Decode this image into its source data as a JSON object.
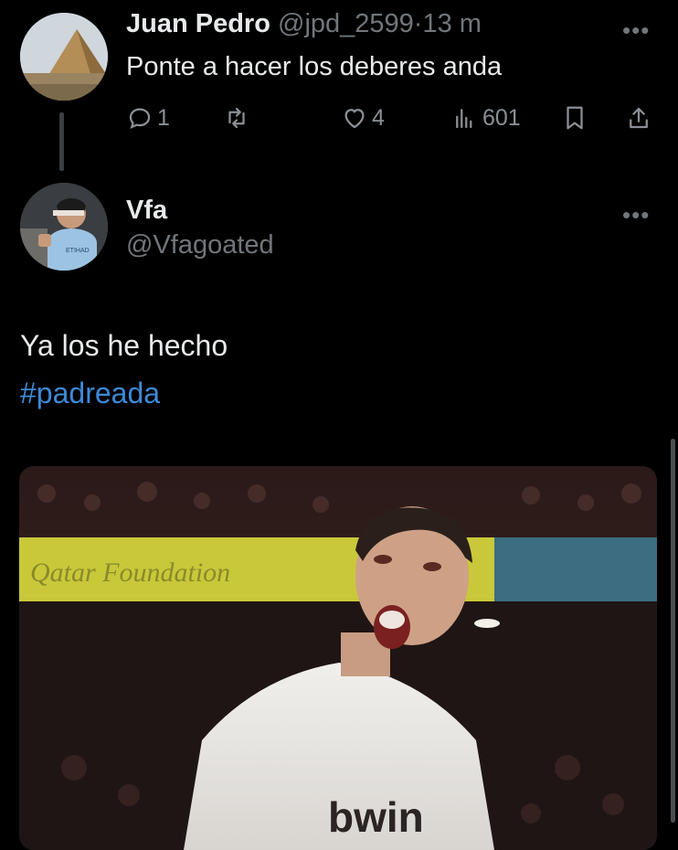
{
  "parent_tweet": {
    "display_name": "Juan Pedro",
    "handle": "@jpd_2599",
    "separator": "·",
    "time": "13 m",
    "text": "Ponte a hacer los deberes anda",
    "replies": "1",
    "likes": "4",
    "views": "601"
  },
  "reply_tweet": {
    "display_name": "Vfa",
    "handle": "@Vfagoated",
    "text": "Ya los he hecho",
    "hashtag": "#padreada",
    "media_banner_text": "Qatar Foundation",
    "jersey_text": "bwin"
  },
  "colors": {
    "background": "#000000",
    "primary_text": "#e7e9ea",
    "secondary_text": "#71767b",
    "hashtag": "#3d8ad8"
  }
}
